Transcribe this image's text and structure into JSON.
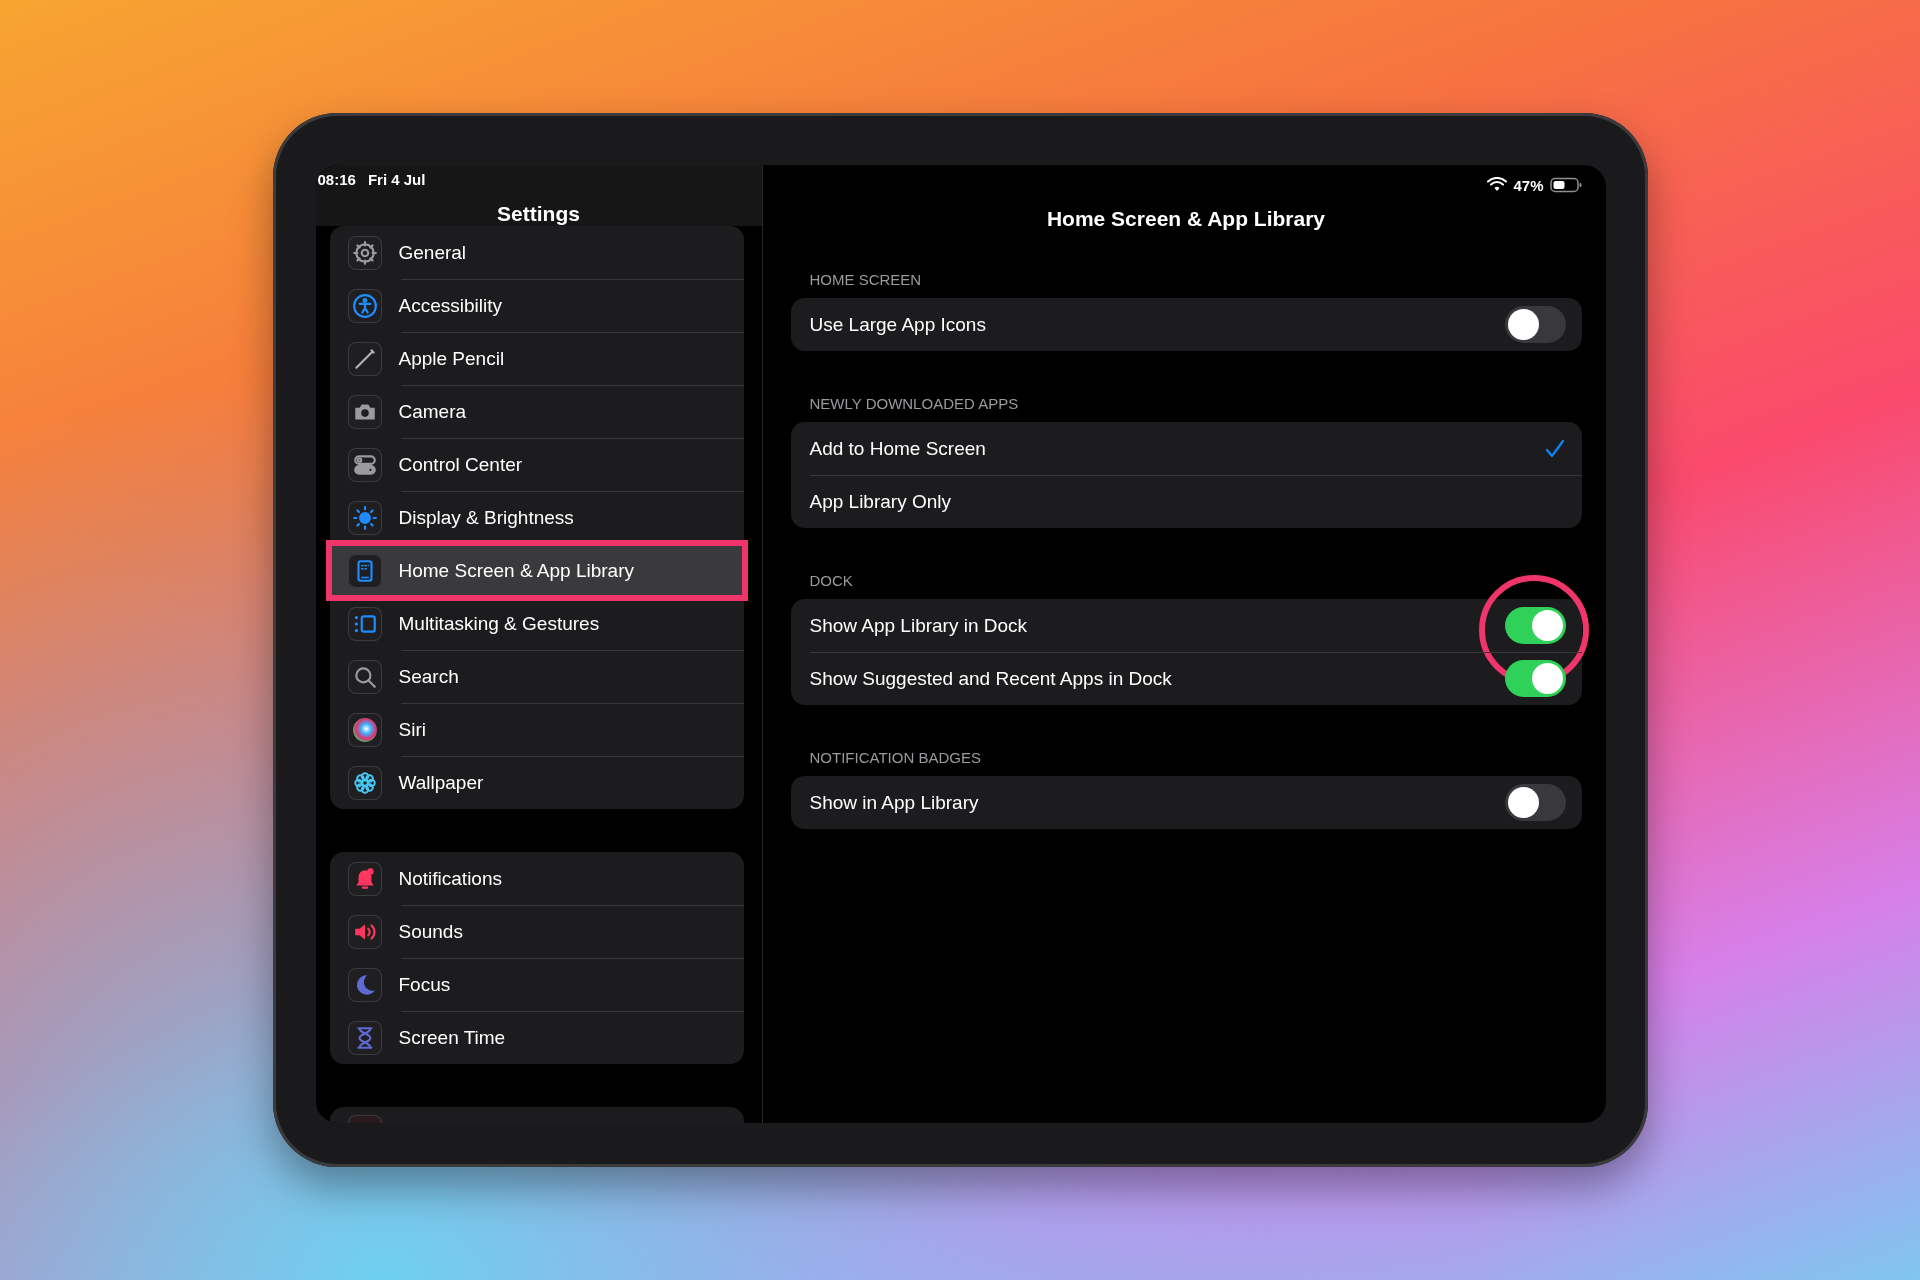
{
  "status_bar": {
    "time": "08:16",
    "date": "Fri 4 Jul",
    "battery": "47%"
  },
  "sidebar": {
    "title": "Settings",
    "groups": [
      {
        "items": [
          {
            "label": "General",
            "kind": "general",
            "selected": false,
            "highlighted": false
          },
          {
            "label": "Accessibility",
            "kind": "accessibility",
            "selected": false,
            "highlighted": false
          },
          {
            "label": "Apple Pencil",
            "kind": "pencil",
            "selected": false,
            "highlighted": false
          },
          {
            "label": "Camera",
            "kind": "camera",
            "selected": false,
            "highlighted": false
          },
          {
            "label": "Control Center",
            "kind": "control",
            "selected": false,
            "highlighted": false
          },
          {
            "label": "Display & Brightness",
            "kind": "display",
            "selected": false,
            "highlighted": false
          },
          {
            "label": "Home Screen & App Library",
            "kind": "home",
            "selected": true,
            "highlighted": true
          },
          {
            "label": "Multitasking & Gestures",
            "kind": "multitasking",
            "selected": false,
            "highlighted": false
          },
          {
            "label": "Search",
            "kind": "search",
            "selected": false,
            "highlighted": false
          },
          {
            "label": "Siri",
            "kind": "siri",
            "selected": false,
            "highlighted": false
          },
          {
            "label": "Wallpaper",
            "kind": "wallpaper",
            "selected": false,
            "highlighted": false
          }
        ]
      },
      {
        "items": [
          {
            "label": "Notifications",
            "kind": "notifications",
            "selected": false,
            "highlighted": false
          },
          {
            "label": "Sounds",
            "kind": "sounds",
            "selected": false,
            "highlighted": false
          },
          {
            "label": "Focus",
            "kind": "focus",
            "selected": false,
            "highlighted": false
          },
          {
            "label": "Screen Time",
            "kind": "screentime",
            "selected": false,
            "highlighted": false
          }
        ]
      }
    ]
  },
  "detail": {
    "title": "Home Screen & App Library",
    "sections": [
      {
        "header": "HOME SCREEN",
        "rows": [
          {
            "label": "Use Large App Icons",
            "kind": "toggle",
            "on": false
          }
        ]
      },
      {
        "header": "NEWLY DOWNLOADED APPS",
        "rows": [
          {
            "label": "Add to Home Screen",
            "kind": "option",
            "selected": true
          },
          {
            "label": "App Library Only",
            "kind": "option",
            "selected": false
          }
        ]
      },
      {
        "header": "DOCK",
        "rows": [
          {
            "label": "Show App Library in Dock",
            "kind": "toggle",
            "on": true,
            "highlighted": true
          },
          {
            "label": "Show Suggested and Recent Apps in Dock",
            "kind": "toggle",
            "on": true
          }
        ]
      },
      {
        "header": "NOTIFICATION BADGES",
        "rows": [
          {
            "label": "Show in App Library",
            "kind": "toggle",
            "on": false
          }
        ]
      }
    ]
  }
}
